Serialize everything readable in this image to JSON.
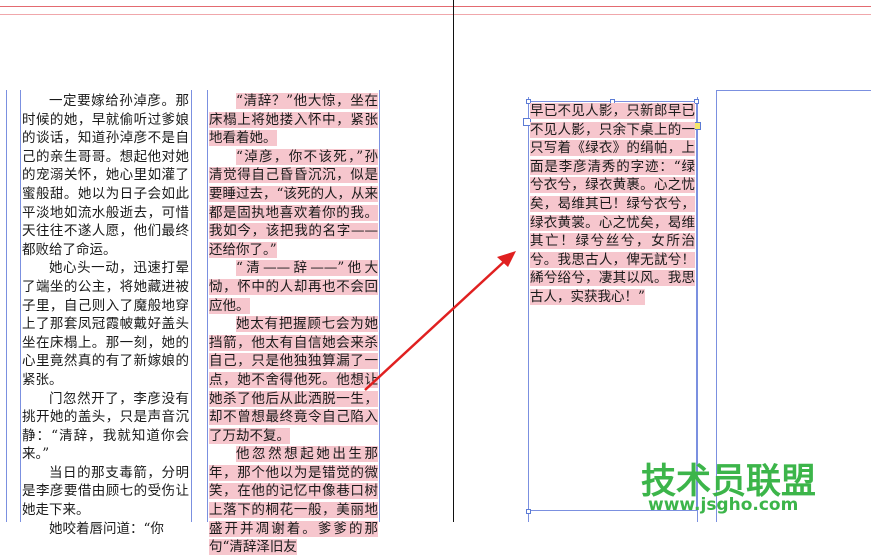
{
  "colors": {
    "guide_red": "#e36a70",
    "guide_blue": "#7b90e0",
    "highlight": "#f6c6cd",
    "arrow": "#e02020",
    "watermark": "#3cb54a"
  },
  "column1": {
    "paragraphs": [
      "一定要嫁给孙淖彦。那时候的她，早就偷听过爹娘的谈话，知道孙淖彦不是自己的亲生哥哥。想起他对她的宠溺关怀，她心里如灌了蜜般甜。她以为日子会如此平淡地如流水般逝去，可惜天往往不遂人愿，他们最终都败给了命运。",
      "她心头一动，迅速打晕了端坐的公主，将她藏进被子里，自己则入了魔般地穿上了那套凤冠霞帔戴好盖头坐在床榻上。那一刻，她的心里竟然真的有了新嫁娘的紧张。",
      "门忽然开了，李彦没有挑开她的盖头，只是声音沉静：“清辞，我就知道你会来。”",
      "当日的那支毒箭，分明是李彦要借由顾七的受伤让她走下来。",
      "她咬着唇问道：“你"
    ]
  },
  "column2": {
    "paragraphs": [
      "“清辞？”他大惊，坐在床榻上将她搂入怀中，紧张地看着她。",
      "“淖彦，你不该死，”孙清觉得自己昏昏沉沉，似是要睡过去，“该死的人，从来都是固执地喜欢着你的我。我如今，该把我的名字——还给你了。”",
      "“清——辞——”他大恸，怀中的人却再也不会回应他。",
      "她太有把握顾七会为她挡箭，他太有自信她会来杀自己，只是他独独算漏了一点，她不舍得他死。他想让她杀了他后从此洒脱一生，却不曾想最终竟令自己陷入了万劫不复。",
      "他忽然想起她出生那年，那个他以为是错觉的微笑，在他的记忆中像巷口树上落下的桐花一般，美丽地盛开并凋谢着。爹爹的那句“清辞泽旧友"
    ]
  },
  "column3": {
    "paragraphs": [
      "早已不见人影，只新郎早已不见人影，只余下桌上的一只写着《绿衣》的绢帕，上面是李彦清秀的字迹：“绿兮衣兮，绿衣黄裹。心之忧矣，曷维其已！绿兮衣兮，绿衣黄裳。心之忧矣，曷维其亡！绿兮丝兮，女所治兮。我思古人，俾无訧兮！絺兮绤兮，凄其以风。我思古人，实获我心！”"
    ]
  },
  "watermark": {
    "brand": "技术员联盟",
    "url": "www.jsgho.com"
  }
}
